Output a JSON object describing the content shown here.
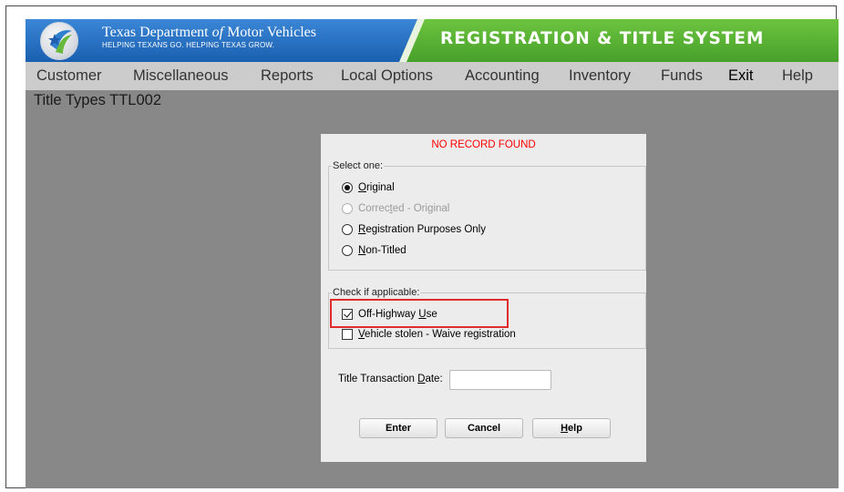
{
  "banner": {
    "org_title_pre": "Texas Department ",
    "org_title_of": "of",
    "org_title_post": " Motor Vehicles",
    "org_tagline": "HELPING TEXANS GO. HELPING TEXAS GROW.",
    "system_title": "REGISTRATION & TITLE SYSTEM",
    "colors": {
      "blue": "#1f6fc4",
      "green": "#57b233"
    }
  },
  "menu": {
    "items": [
      "Customer",
      "Miscellaneous",
      "Reports",
      "Local Options",
      "Accounting",
      "Inventory",
      "Funds",
      "Exit",
      "Help"
    ]
  },
  "screen": {
    "title": "Title Types TTL002"
  },
  "dialog": {
    "message": "NO RECORD FOUND",
    "message_color": "#ff0000",
    "select_group_label": "Select one:",
    "options": [
      {
        "pre": "",
        "mnemonic": "O",
        "post": "riginal",
        "selected": true,
        "enabled": true
      },
      {
        "pre": "Correc",
        "mnemonic": "t",
        "post": "ed - Original",
        "selected": false,
        "enabled": false
      },
      {
        "pre": "",
        "mnemonic": "R",
        "post": "egistration Purposes Only",
        "selected": false,
        "enabled": true
      },
      {
        "pre": "",
        "mnemonic": "N",
        "post": "on-Titled",
        "selected": false,
        "enabled": true
      }
    ],
    "check_group_label": "Check if applicable:",
    "checkboxes": [
      {
        "pre": "Off-Highway ",
        "mnemonic": "U",
        "post": "se",
        "checked": true
      },
      {
        "pre": "",
        "mnemonic": "V",
        "post": "ehicle stolen - Waive registration",
        "checked": false
      }
    ],
    "date_label_pre": "Title Transaction ",
    "date_label_mnemonic": "D",
    "date_label_post": "ate:",
    "date_value": "",
    "buttons": {
      "enter": "Enter",
      "cancel": "Cancel",
      "help_mnemonic": "H",
      "help_post": "elp"
    }
  }
}
